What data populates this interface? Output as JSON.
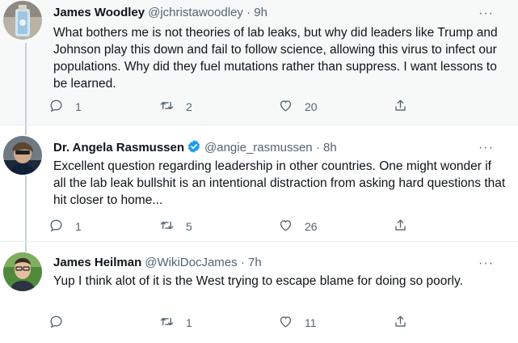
{
  "tweets": [
    {
      "name": "James Woodley",
      "handle": "@jchristawoodley",
      "separator": "·",
      "time": "9h",
      "verified": false,
      "more": "···",
      "text": "What bothers me is not theories of lab leaks, but why did leaders like Trump and Johnson play this down and fail to follow science, allowing this virus to infect our populations. Why did they fuel mutations rather than suppress. I want lessons to be learned.",
      "replies": "1",
      "retweets": "2",
      "likes": "20"
    },
    {
      "name": "Dr. Angela Rasmussen",
      "handle": "@angie_rasmussen",
      "separator": "·",
      "time": "8h",
      "verified": true,
      "more": "···",
      "text": "Excellent question regarding leadership in other countries. One might wonder if all the lab leak bullshit is an intentional distraction from asking hard questions that hit closer to home...",
      "replies": "1",
      "retweets": "5",
      "likes": "26"
    },
    {
      "name": "James Heilman",
      "handle": "@WikiDocJames",
      "separator": "·",
      "time": "7h",
      "verified": false,
      "more": "···",
      "text": "Yup I think alot of it is the West trying to escape blame for doing so poorly.",
      "replies": "",
      "retweets": "1",
      "likes": "11"
    }
  ],
  "icons": {
    "reply": "reply-icon",
    "retweet": "retweet-icon",
    "like": "heart-icon",
    "share": "share-icon",
    "verified": "verified-badge-icon",
    "more": "more-icon"
  },
  "colors": {
    "verified_blue": "#1d9bf0",
    "muted_text": "#536471",
    "highlight_bg": "#f7f9f9"
  }
}
